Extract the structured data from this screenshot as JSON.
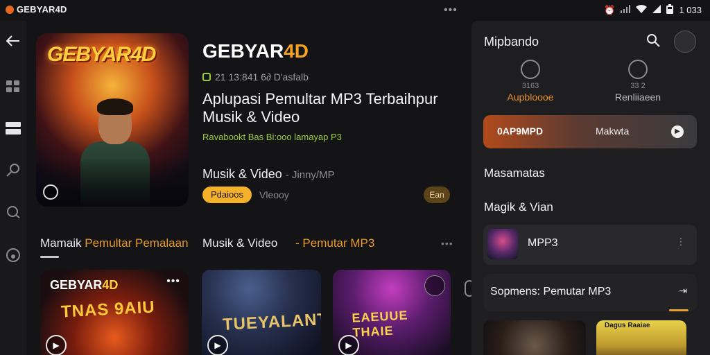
{
  "statusbar": {
    "brand": "GEBYAR4D",
    "overflow": "•••",
    "clock": "1 033",
    "icons": [
      "alarm-icon",
      "signal-icon",
      "wifi-icon",
      "cell-icon",
      "battery-icon"
    ]
  },
  "rail": {
    "icons": [
      "back-arrow-icon",
      "grid-icon",
      "library-icon",
      "search-icon",
      "headphones-icon",
      "disc-icon"
    ]
  },
  "hero": {
    "art_logo": "GEBYAR4D",
    "title_main": "GEBYAR",
    "title_accent": "4D",
    "meta": "21 13:841 6∂ D'asfalb",
    "headline": "Aplupasi Pemultar MP3 Terbaihpur Musik & Video",
    "subline": "Ravabookt Bas Bi:ooo lamayap P3",
    "category": "Musik & Video",
    "category_suffix": "- Jinny/MP",
    "primary_pill": "Pdaioos",
    "secondary": "Vleooy",
    "small_pill": "Ean"
  },
  "tabs": {
    "t1": "Mamaik",
    "t1_accent": "Pemultar Pemalaan",
    "t2": "Musik & Video",
    "t3_prefix": "-",
    "t3_accent": "Pemutar MP3",
    "more": "•••"
  },
  "cards": [
    {
      "title_a": "GEBYAR",
      "title_b": "4D",
      "big": "TNAS 9AIU",
      "dots": "•••"
    },
    {
      "title_a": "",
      "title_b": "",
      "big": "TUEYALANT",
      "dots": ""
    },
    {
      "title_a": "",
      "title_b": "",
      "big": "EAEUUE THAIE",
      "dots": ""
    }
  ],
  "panel": {
    "title": "Mipbando",
    "stat1_num": "3163",
    "stat1_label": "Aupbloooe",
    "stat2_num": "33 2",
    "stat2_label": "Renliiaeen",
    "cta_left": "0AP9MPD",
    "cta_mid": "Makwta",
    "section1": "Masamatas",
    "section2": "Magik & Vian",
    "row1_label": "MPP3",
    "row1_more": "⋮",
    "row2_label": "Sopmens: Pemutar MP3",
    "row2_icon": "⇥",
    "thumb_b_text": "Dagus Raaiae"
  },
  "colors": {
    "accent": "#f5a321",
    "background": "#141416",
    "panel": "#1e1e21",
    "green": "#9ccb3d"
  }
}
